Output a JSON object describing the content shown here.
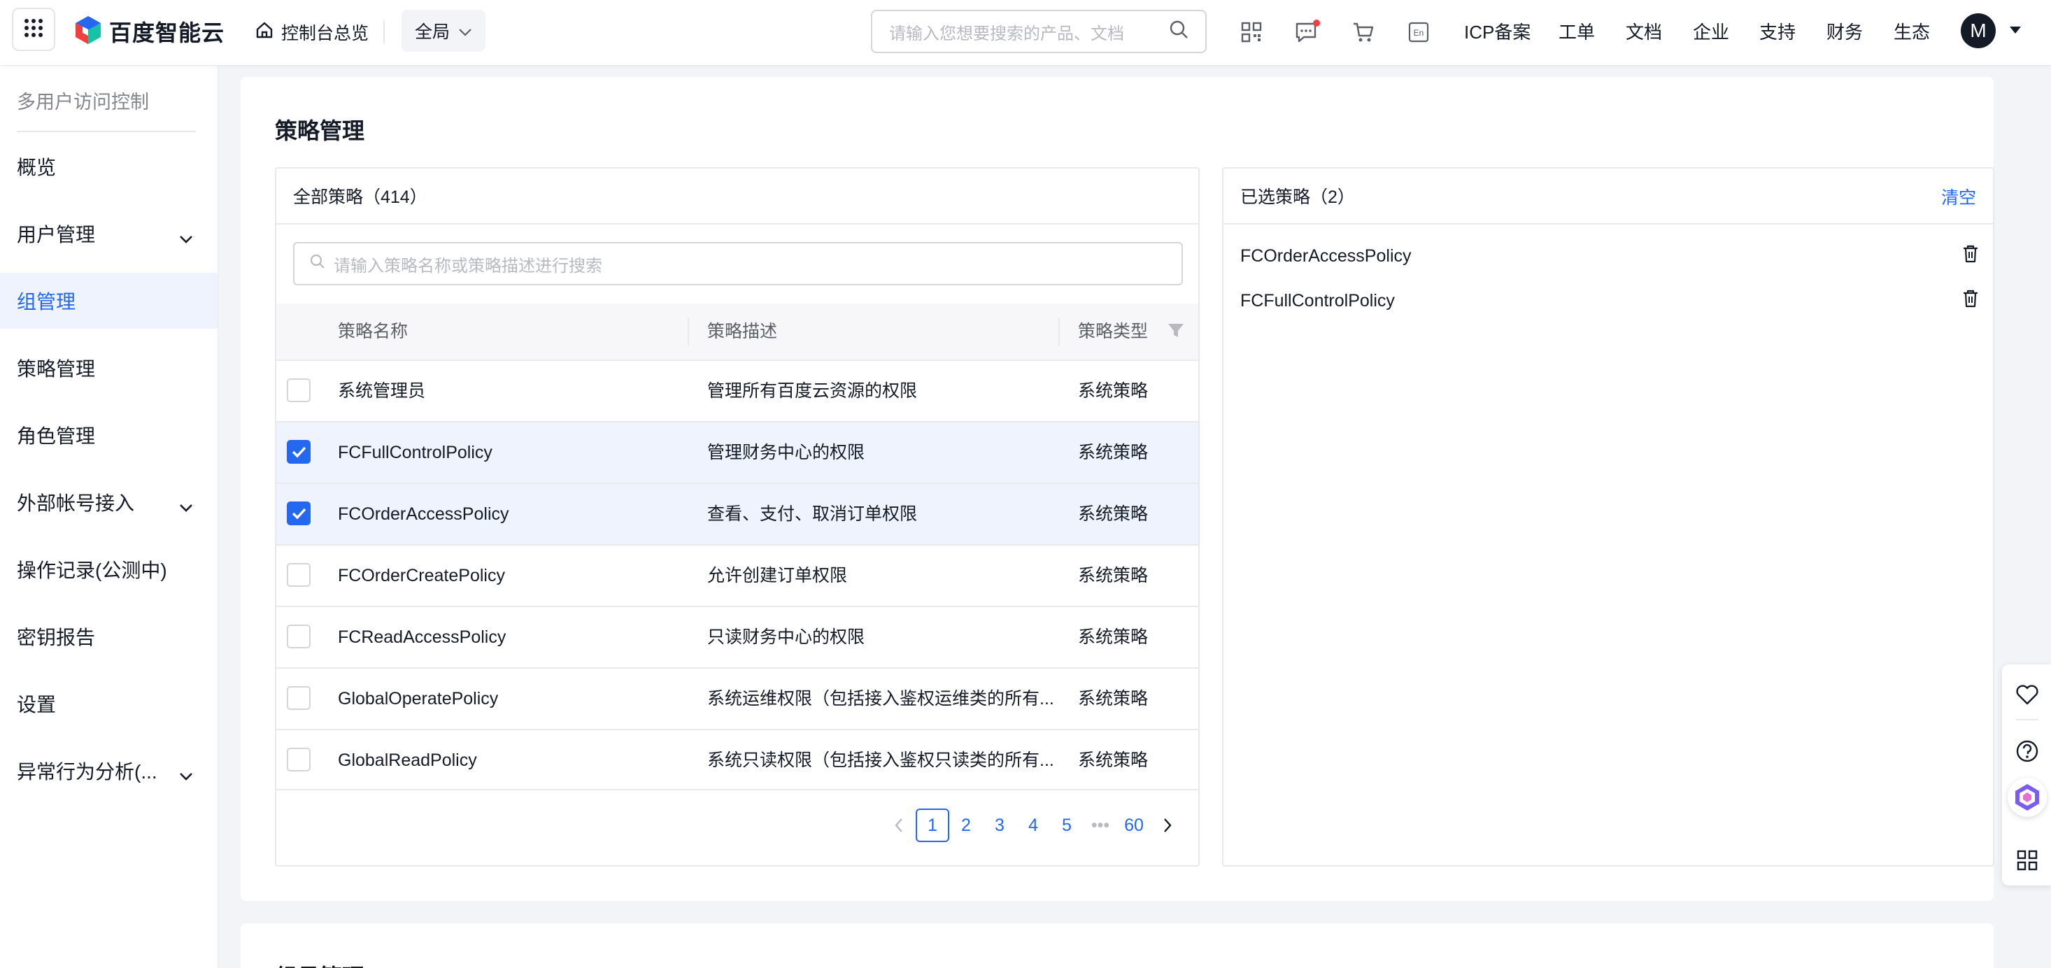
{
  "topbar": {
    "logo_text": "百度智能云",
    "home_label": "控制台总览",
    "region_label": "全局",
    "search_placeholder": "请输入您想要搜索的产品、文档",
    "links": [
      "ICP备案",
      "工单",
      "文档",
      "企业",
      "支持",
      "财务",
      "生态"
    ],
    "avatar_letter": "M",
    "notification_dot_color": "#f33e3e"
  },
  "sidebar": {
    "title": "多用户访问控制",
    "items": [
      {
        "label": "概览",
        "expandable": false,
        "active": false
      },
      {
        "label": "用户管理",
        "expandable": true,
        "active": false
      },
      {
        "label": "组管理",
        "expandable": false,
        "active": true
      },
      {
        "label": "策略管理",
        "expandable": false,
        "active": false
      },
      {
        "label": "角色管理",
        "expandable": false,
        "active": false
      },
      {
        "label": "外部帐号接入",
        "expandable": true,
        "active": false
      },
      {
        "label": "操作记录(公测中)",
        "expandable": false,
        "active": false
      },
      {
        "label": "密钥报告",
        "expandable": false,
        "active": false
      },
      {
        "label": "设置",
        "expandable": false,
        "active": false
      },
      {
        "label": "异常行为分析(...",
        "expandable": true,
        "active": false
      }
    ]
  },
  "main": {
    "title": "策略管理",
    "next_section_title": "组员管理",
    "all_policies": {
      "header": "全部策略（414）",
      "search_placeholder": "请输入策略名称或策略描述进行搜索",
      "columns": {
        "name": "策略名称",
        "desc": "策略描述",
        "type": "策略类型"
      },
      "rows": [
        {
          "name": "系统管理员",
          "desc": "管理所有百度云资源的权限",
          "type": "系统策略",
          "checked": false
        },
        {
          "name": "FCFullControlPolicy",
          "desc": "管理财务中心的权限",
          "type": "系统策略",
          "checked": true
        },
        {
          "name": "FCOrderAccessPolicy",
          "desc": "查看、支付、取消订单权限",
          "type": "系统策略",
          "checked": true
        },
        {
          "name": "FCOrderCreatePolicy",
          "desc": "允许创建订单权限",
          "type": "系统策略",
          "checked": false
        },
        {
          "name": "FCReadAccessPolicy",
          "desc": "只读财务中心的权限",
          "type": "系统策略",
          "checked": false
        },
        {
          "name": "GlobalOperatePolicy",
          "desc": "系统运维权限（包括接入鉴权运维类的所有...",
          "type": "系统策略",
          "checked": false
        },
        {
          "name": "GlobalReadPolicy",
          "desc": "系统只读权限（包括接入鉴权只读类的所有...",
          "type": "系统策略",
          "checked": false
        }
      ],
      "pagination": {
        "pages": [
          "1",
          "2",
          "3",
          "4",
          "5"
        ],
        "ellipsis": "•••",
        "last": "60",
        "current": "1"
      }
    },
    "selected_policies": {
      "header": "已选策略（2）",
      "clear_label": "清空",
      "items": [
        "FCOrderAccessPolicy",
        "FCFullControlPolicy"
      ]
    }
  },
  "colors": {
    "accent": "#2468f2",
    "active_bg": "#eef3fe",
    "text": "#151b26",
    "muted": "#84868c"
  },
  "icons": [
    "grid-icon",
    "home-icon",
    "chevron-down-icon",
    "search-icon",
    "qrcode-icon",
    "message-icon",
    "cart-icon",
    "language-icon",
    "filter-icon",
    "trash-icon",
    "chevron-left-icon",
    "chevron-right-icon",
    "heart-icon",
    "help-icon",
    "ai-assistant-icon",
    "apps-icon"
  ]
}
